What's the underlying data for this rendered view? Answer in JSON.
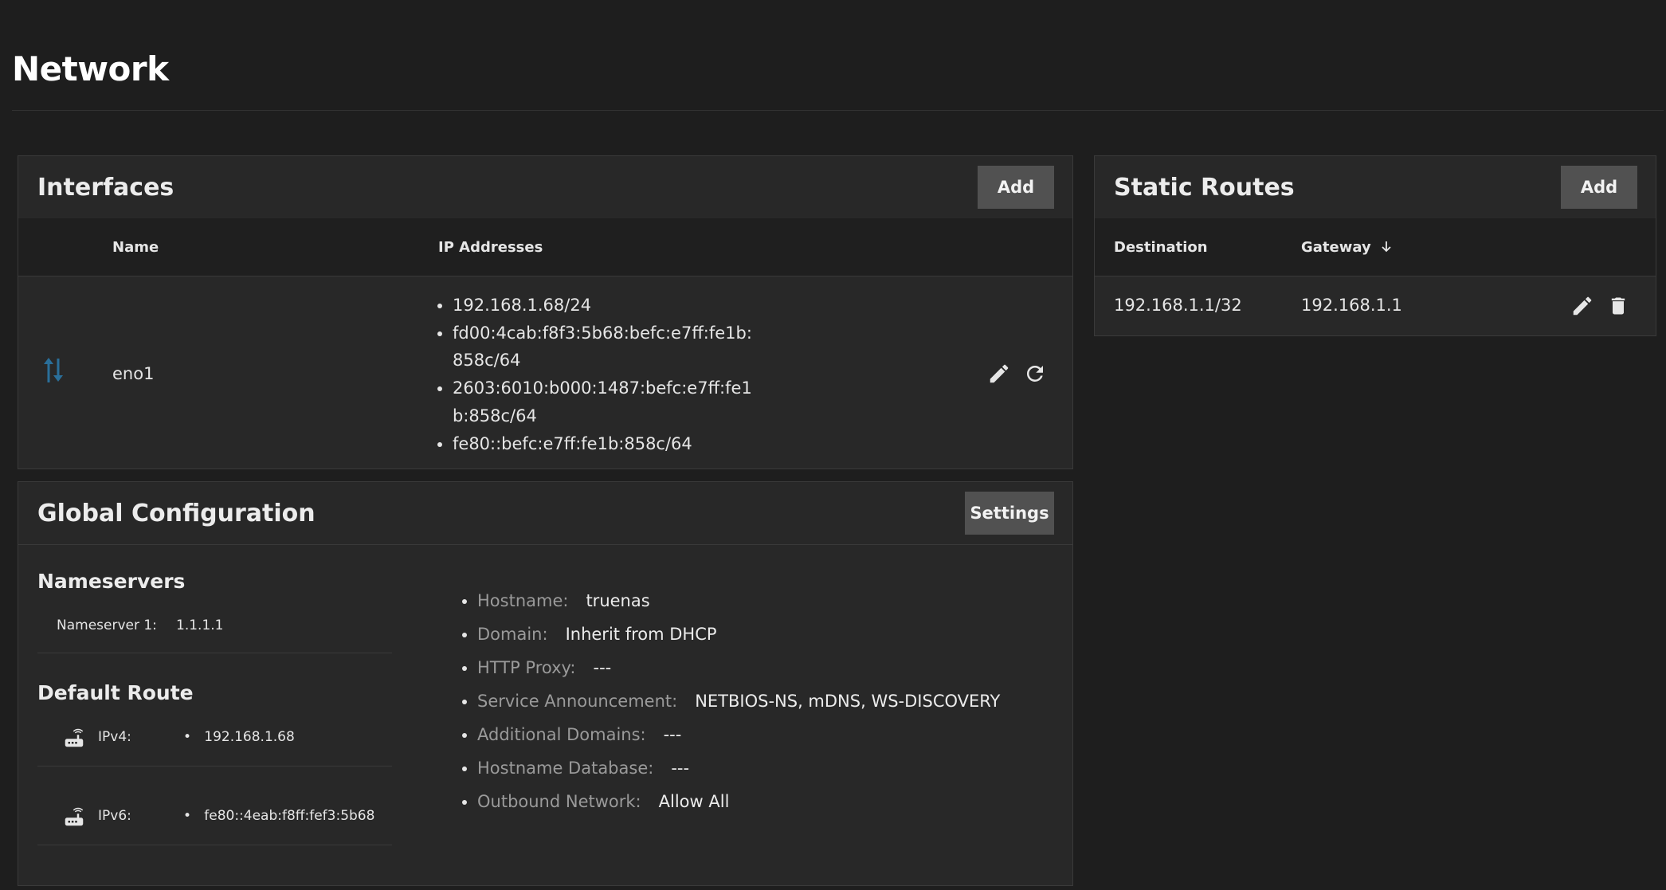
{
  "page": {
    "title": "Network"
  },
  "interfaces": {
    "title": "Interfaces",
    "add_label": "Add",
    "columns": {
      "name": "Name",
      "ip_addresses": "IP Addresses"
    },
    "rows": [
      {
        "name": "eno1",
        "icon": "network-transfer-icon",
        "ip_addresses": [
          "192.168.1.68/24",
          "fd00:4cab:f8f3:5b68:befc:e7ff:fe1b:858c/64",
          "2603:6010:b000:1487:befc:e7ff:fe1b:858c/64",
          "fe80::befc:e7ff:fe1b:858c/64"
        ]
      }
    ]
  },
  "static_routes": {
    "title": "Static Routes",
    "add_label": "Add",
    "columns": {
      "destination": "Destination",
      "gateway": "Gateway"
    },
    "rows": [
      {
        "destination": "192.168.1.1/32",
        "gateway": "192.168.1.1"
      }
    ]
  },
  "global_config": {
    "title": "Global Configuration",
    "settings_label": "Settings",
    "nameservers": {
      "title": "Nameservers",
      "items": [
        {
          "label": "Nameserver 1:",
          "value": "1.1.1.1"
        }
      ]
    },
    "default_route": {
      "title": "Default Route",
      "ipv4": {
        "label": "IPv4:",
        "value": "192.168.1.68"
      },
      "ipv6": {
        "label": "IPv6:",
        "value": "fe80::4eab:f8ff:fef3:5b68"
      }
    },
    "details": [
      {
        "label": "Hostname:",
        "value": "truenas"
      },
      {
        "label": "Domain:",
        "value": "Inherit from DHCP"
      },
      {
        "label": "HTTP Proxy:",
        "value": "---"
      },
      {
        "label": "Service Announcement:",
        "value": "NETBIOS-NS, mDNS, WS-DISCOVERY"
      },
      {
        "label": "Additional Domains:",
        "value": "---"
      },
      {
        "label": "Hostname Database:",
        "value": "---"
      },
      {
        "label": "Outbound Network:",
        "value": "Allow All"
      }
    ]
  },
  "colors": {
    "background": "#1e1e1e",
    "card": "#282828",
    "button": "#515151",
    "interface_icon": "#2a6f9a"
  }
}
